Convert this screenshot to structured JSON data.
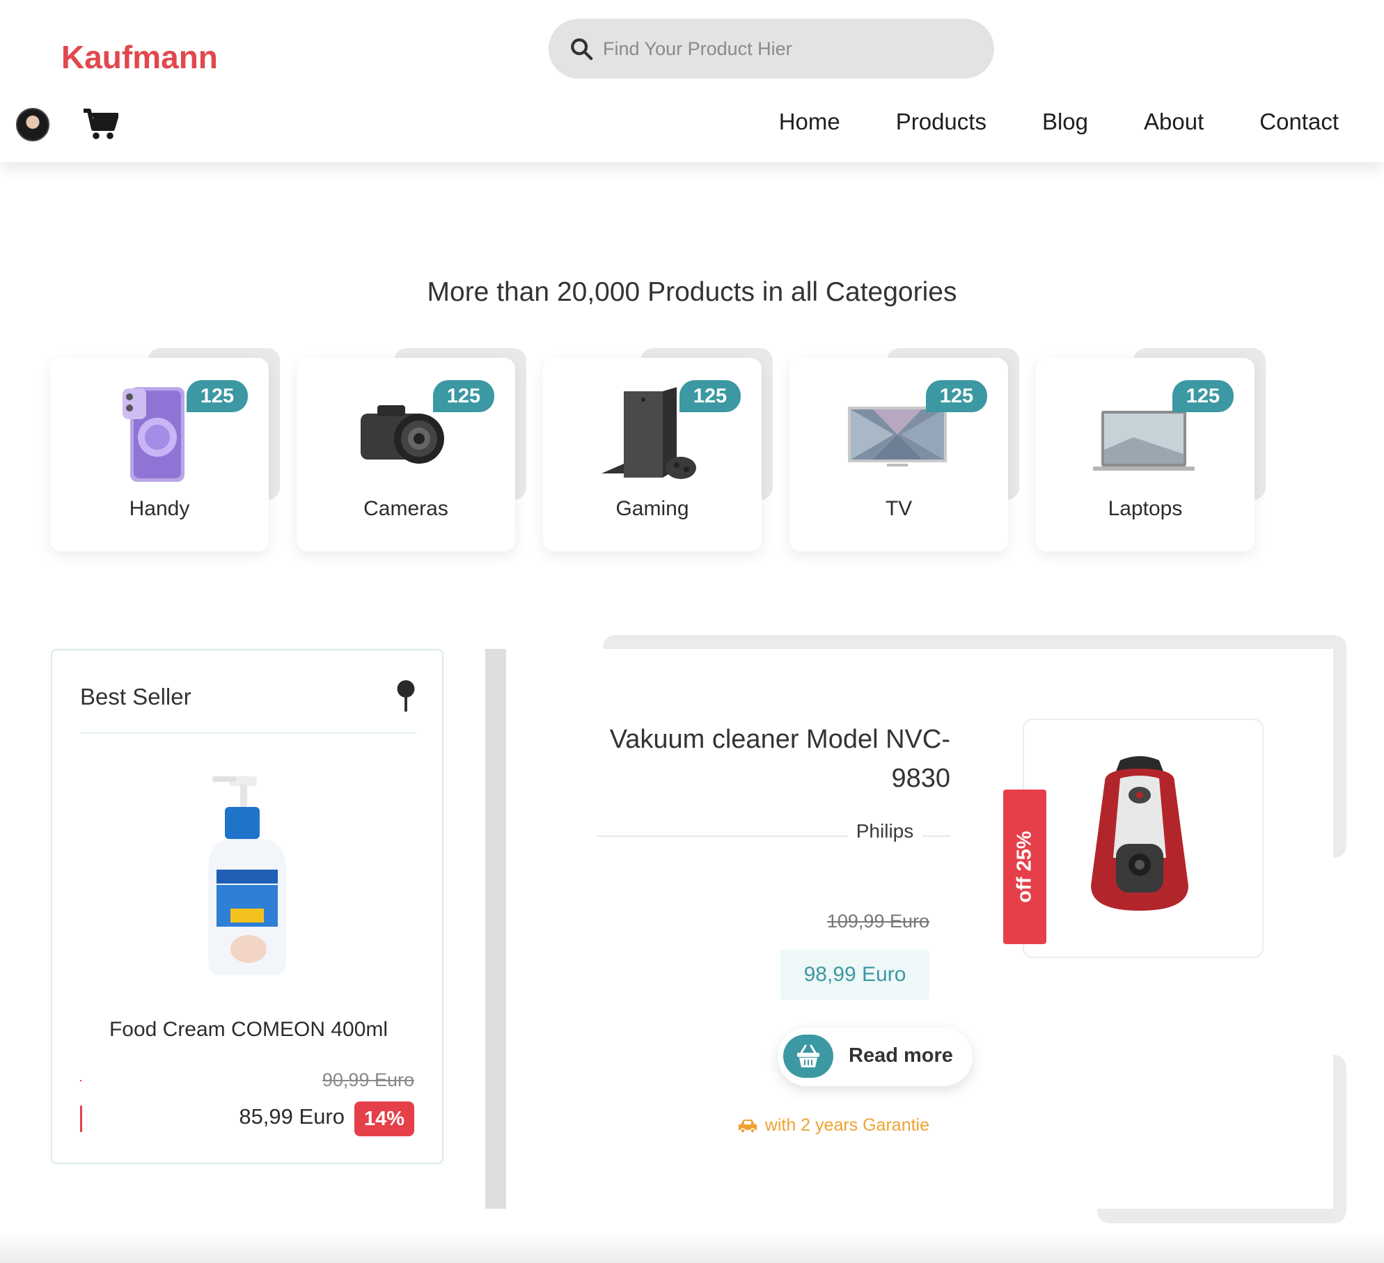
{
  "header": {
    "logo": "Kaufmann",
    "search_placeholder": "Find Your Product Hier",
    "nav": [
      "Home",
      "Products",
      "Blog",
      "About",
      "Contact"
    ]
  },
  "section_title": "More than 20,000 Products in all Categories",
  "categories": [
    {
      "name": "Handy",
      "count": "125",
      "icon": "phone-image"
    },
    {
      "name": "Cameras",
      "count": "125",
      "icon": "camera-image"
    },
    {
      "name": "Gaming",
      "count": "125",
      "icon": "console-image"
    },
    {
      "name": "TV",
      "count": "125",
      "icon": "tv-image"
    },
    {
      "name": "Laptops",
      "count": "125",
      "icon": "laptop-image"
    }
  ],
  "best_seller": {
    "title": "Best Seller",
    "product_name": "Food Cream COMEON 400ml",
    "old_price": "90,99 Euro",
    "new_price": "85,99 Euro",
    "discount": "14%"
  },
  "featured": {
    "title": "Vakuum cleaner Model NVC-9830",
    "brand": "Philips",
    "old_price": "109,99 Euro",
    "new_price": "98,99 Euro",
    "button": "Read more",
    "guarantee": "with 2 years Garantie",
    "offer_tag": "off 25%"
  },
  "colors": {
    "brand": "#e0484e",
    "accent": "#3c98a2",
    "sale": "#e5404a",
    "guarantee": "#f0a232"
  }
}
